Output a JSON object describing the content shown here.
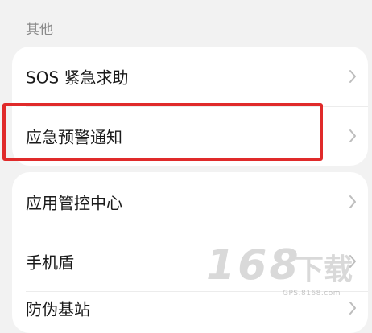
{
  "section": {
    "title": "其他"
  },
  "group_one": [
    {
      "label": "SOS 紧急求助"
    },
    {
      "label": "应急预警通知"
    }
  ],
  "group_two": [
    {
      "label": "应用管控中心"
    },
    {
      "label": "手机盾"
    },
    {
      "label": "防伪基站"
    }
  ],
  "watermark": {
    "logo": "168",
    "text": "下载",
    "url": "GPS.8168.com"
  },
  "colors": {
    "highlight": "#e02a2a",
    "background": "#f2f2f2"
  }
}
